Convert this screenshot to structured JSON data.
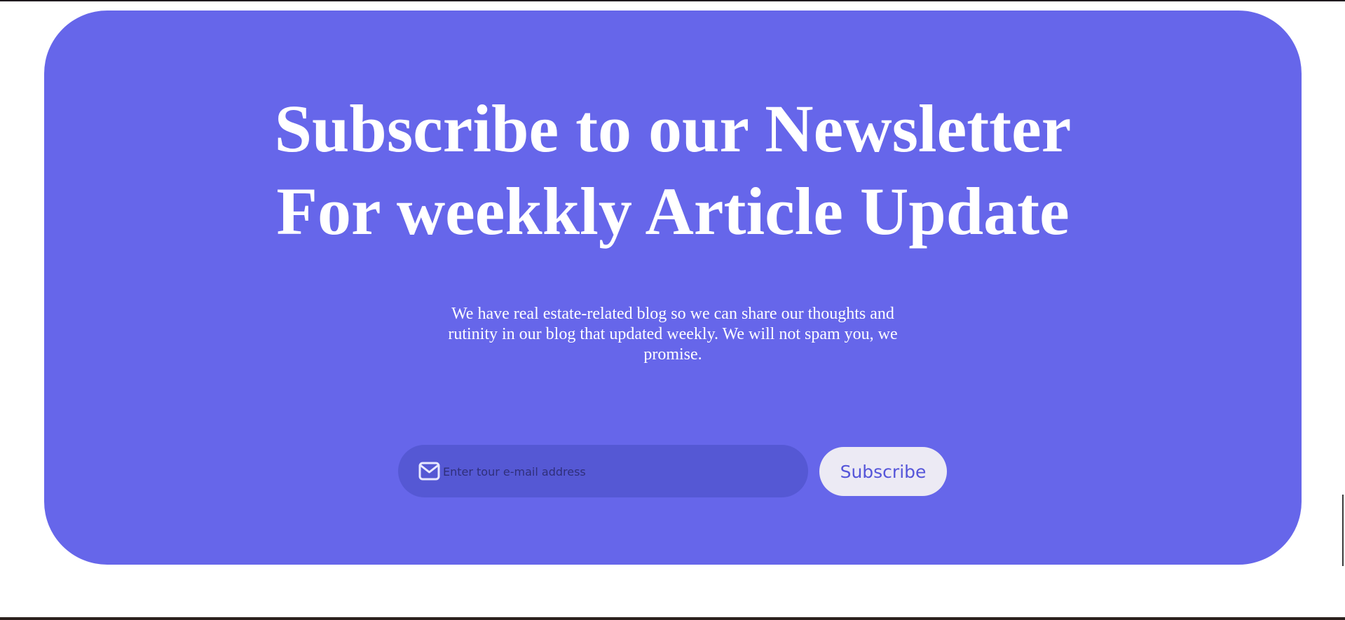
{
  "newsletter": {
    "heading_line1": "Subscribe to our Newsletter",
    "heading_line2": "For weekkly Article Update",
    "description": "We have real estate-related blog so we can share our thoughts and rutinity in our blog that updated weekly. We will not spam you, we promise.",
    "email_placeholder": "Enter tour e-mail address",
    "email_value": "",
    "email_icon": "mail-icon",
    "subscribe_label": "Subscribe"
  },
  "colors": {
    "card_background": "#6666ea",
    "input_background": "#5558d4",
    "button_background": "#eceaf4",
    "button_text": "#5555d9",
    "heading_text": "#ffffff"
  }
}
